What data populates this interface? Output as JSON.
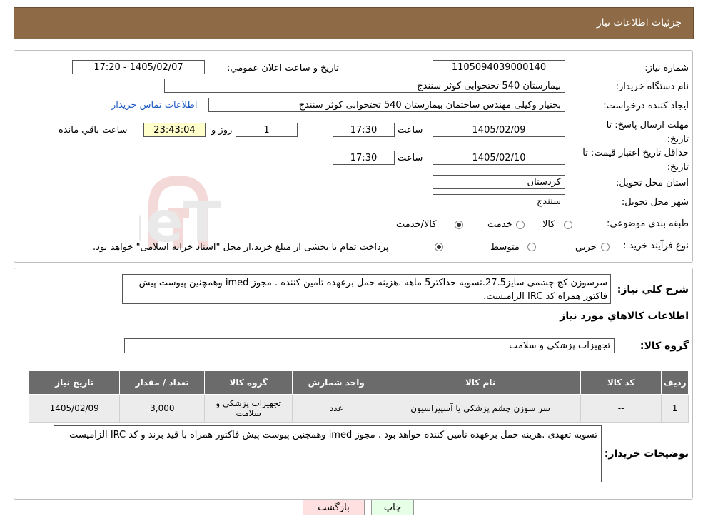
{
  "header": {
    "title": "جزئیات اطلاعات نیاز"
  },
  "form": {
    "need_number_label": "شماره نیاز:",
    "need_number": "1105094039000140",
    "announce_label": "تاریخ و ساعت اعلان عمومي:",
    "announce_value": "1405/02/07 - 17:20",
    "buyer_org_label": "نام دستگاه خريدار:",
    "buyer_org": "بیمارستان 540 تختخوابی کوثر سنندج",
    "requester_label": "ايجاد کننده درخواست:",
    "requester": "بختیار وکیلی مهندس ساختمان بیمارستان 540 تختخوابی کوثر سنندج",
    "contact_link": "اطلاعات تماس خریدار",
    "send_deadline_label": "مهلت ارسال پاسخ: تا تاریخ:",
    "send_date": "1405/02/09",
    "time_label": "ساعت",
    "send_time": "17:30",
    "days_value": "1",
    "days_label": "روز و",
    "remaining_time": "23:43:04",
    "remaining_label": "ساعت باقي مانده",
    "validity_label": "حداقل تاریخ اعتبار قیمت: تا تاریخ:",
    "validity_date": "1405/02/10",
    "validity_time": "17:30",
    "province_label": "استان محل تحویل:",
    "province": "کردستان",
    "city_label": "شهر محل تحویل:",
    "city": "سنندج",
    "category_label": "طبقه بندی موضوعی:",
    "category_options": [
      "کالا",
      "خدمت",
      "کالا/خدمت"
    ],
    "process_label": "نوع فرآیند خرید :",
    "process_options": [
      "جزیي",
      "متوسط"
    ],
    "process_note": "پرداخت تمام یا بخشی از مبلغ خرید،از محل \"اسناد خزانه اسلامی\" خواهد بود."
  },
  "description": {
    "label": "شرح کلي نياز:",
    "text": "سرسوزن کج چشمی سایز27.5.تسویه حداکثر5 ماهه .هزینه حمل برعهده تامین کننده . مجوز imed وهمچنین پیوست پیش فاکتور همراه کد IRC  الزامیست."
  },
  "goods": {
    "section_title": "اطلاعات کالاهاي مورد نياز",
    "group_label": "گروه کالا:",
    "group_value": "تجهیزات پزشکی و سلامت",
    "columns": [
      "رديف",
      "کد کالا",
      "نام کالا",
      "واحد شمارش",
      "گروه کالا",
      "تعداد / مقدار",
      "تاريخ نياز"
    ],
    "rows": [
      {
        "row": "1",
        "code": "--",
        "name": "سر سوزن چشم پزشکی یا آسپیراسیون",
        "unit": "عدد",
        "group": "تجهیزات پزشکی و سلامت",
        "qty": "3,000",
        "date": "1405/02/09"
      }
    ]
  },
  "buyer_notes": {
    "label": "توضيحات خريدار:",
    "text": "تسویه تعهدی .هزینه حمل برعهده تامین کننده خواهد بود . مجوز imed وهمچنین پیوست پیش فاکتور همراه  با قید برند و کد IRC  الزامیست"
  },
  "buttons": {
    "print": "چاپ",
    "back": "بازگشت"
  },
  "watermark": {
    "text": "AriaTender.neT"
  },
  "colors": {
    "header_bg": "#8e6b46",
    "table_header": "#6b6b6b",
    "link": "#1a57c4",
    "remaining_bg": "#ffffcc",
    "back_btn": "#ffe0e0",
    "print_btn": "#e6ffe6"
  }
}
